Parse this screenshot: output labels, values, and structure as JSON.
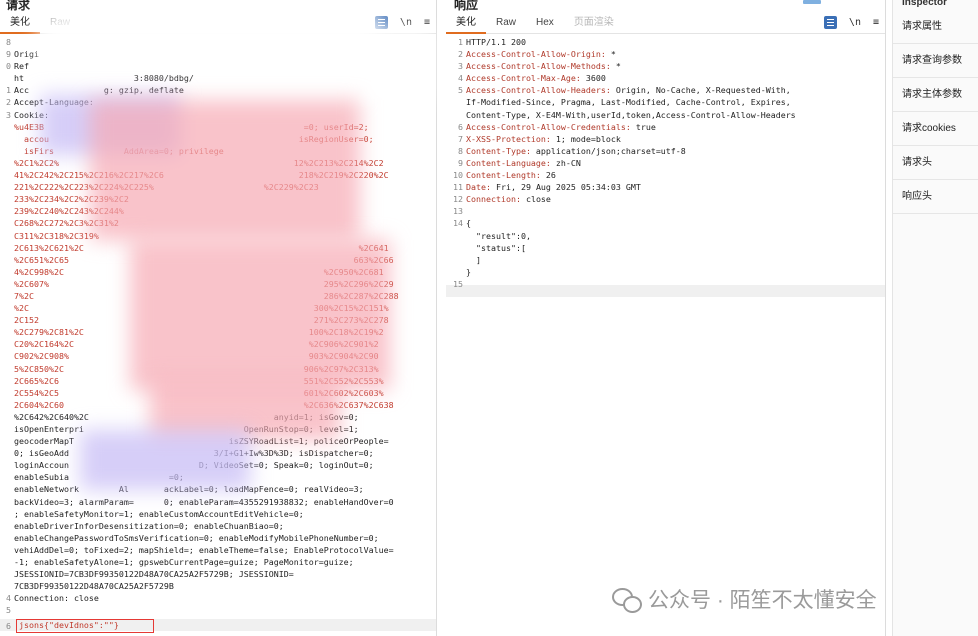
{
  "request": {
    "title": "请求",
    "tabs": [
      "美化",
      "Raw"
    ],
    "tools": {
      "format_icon": "lines-icon",
      "newline_label": "\\n",
      "menu_label": "≡"
    },
    "lines": [
      {
        "n": "8",
        "text": ""
      },
      {
        "n": "9",
        "text": "Origi"
      },
      {
        "n": "0",
        "text": "Ref"
      },
      {
        "n": "",
        "text": "ht                      3:8080/bdbg/"
      },
      {
        "n": "1",
        "text": "Acc               g: gzip, deflate"
      },
      {
        "n": "2",
        "text": "Accept-Language:"
      },
      {
        "n": "3",
        "text": "Cookie:"
      },
      {
        "n": "",
        "text": "%u4E3B                                                    =0; userId=2;"
      },
      {
        "n": "",
        "text": "  accou                                                  isRegionUser=0;"
      },
      {
        "n": "",
        "text": "  isFirs              AddArea=0; privilege"
      },
      {
        "n": "",
        "text": "%2C1%2C2%                                               12%2C213%2C214%2C2"
      },
      {
        "n": "",
        "text": "41%2C242%2C215%2C216%2C217%2C6                           218%2C219%2C220%2C"
      },
      {
        "n": "",
        "text": "221%2C222%2C223%2C224%2C225%                      %2C229%2C23"
      },
      {
        "n": "",
        "text": "233%2C234%2C2%2C239%2C2"
      },
      {
        "n": "",
        "text": "239%2C240%2C243%2C244%"
      },
      {
        "n": "",
        "text": "C268%2C272%2C3%2C31%2"
      },
      {
        "n": "",
        "text": "C311%2C318%2C319%"
      },
      {
        "n": "",
        "text": "2C613%2C621%2C                                                       %2C641"
      },
      {
        "n": "",
        "text": "%2C651%2C65                                                         663%2C66"
      },
      {
        "n": "",
        "text": "4%2C998%2C                                                    %2C950%2C681"
      },
      {
        "n": "",
        "text": "%2C607%                                                       295%2C296%2C29"
      },
      {
        "n": "",
        "text": "7%2C                                                          286%2C287%2C288"
      },
      {
        "n": "",
        "text": "%2C                                                         300%2C15%2C151%"
      },
      {
        "n": "",
        "text": "2C152                                                       271%2C273%2C278"
      },
      {
        "n": "",
        "text": "%2C279%2C81%2C                                             100%2C18%2C19%2"
      },
      {
        "n": "",
        "text": "C20%2C164%2C                                               %2C906%2C901%2"
      },
      {
        "n": "",
        "text": "C902%2C908%                                                903%2C904%2C90"
      },
      {
        "n": "",
        "text": "5%2C850%2C                                                906%2C97%2C313%"
      },
      {
        "n": "",
        "text": "2C665%2C6                                                 551%2C552%2C553%"
      },
      {
        "n": "",
        "text": "2C554%2C5                                                 601%2C602%2C603%"
      },
      {
        "n": "",
        "text": "2C604%2C60                                                %2C636%2C637%2C638"
      },
      {
        "n": "",
        "text": "%2C642%2C640%2C                                     anyid=1; isGov=0;"
      },
      {
        "n": "",
        "text": "isOpenEnterpri                                OpenRunStop=0; level=1;"
      },
      {
        "n": "",
        "text": "geocoderMapT                               isZSYRoadList=1; policeOrPeople="
      },
      {
        "n": "",
        "text": "0; isGeoAdd                             3/I+G1+Iw%3D%3D; isDispatcher=0;"
      },
      {
        "n": "",
        "text": "loginAccoun                          D; VideoSet=0; Speak=0; loginOut=0;"
      },
      {
        "n": "",
        "text": "enableSubia                    =0;"
      },
      {
        "n": "",
        "text": "enableNetwork        Al       ackLabel=0; loadMapFence=0; realVideo=3;"
      },
      {
        "n": "",
        "text": "backVideo=3; alarmParam=      0; enableParam=4355291938832; enableHandOver=0"
      },
      {
        "n": "",
        "text": "; enableSafetyMonitor=1; enableCustomAccountEditVehicle=0;"
      },
      {
        "n": "",
        "text": "enableDriverInforDesensitization=0; enableChuanBiao=0;"
      },
      {
        "n": "",
        "text": "enableChangePasswordToSmsVerification=0; enableModifyMobilePhoneNumber=0;"
      },
      {
        "n": "",
        "text": "vehiAddDel=0; toFixed=2; mapShield=; enableTheme=false; EnableProtocolValue="
      },
      {
        "n": "",
        "text": "-1; enableSafetyAlone=1; gpswebCurrentPage=guize; PageMonitor=guize;"
      },
      {
        "n": "",
        "text": "JSESSIONID=7CB3DF99350122D48A70CA25A2F5729B; JSESSIONID="
      },
      {
        "n": "",
        "text": "7CB3DF99350122D48A70CA25A2F5729B"
      },
      {
        "n": "4",
        "text": "Connection: close"
      },
      {
        "n": "5",
        "text": ""
      }
    ],
    "last_line_no": "6",
    "body_text": "jsons{\"devIdnos\":\"\"}"
  },
  "response": {
    "title": "响应",
    "tabs": [
      "美化",
      "Raw",
      "Hex",
      "页面渲染"
    ],
    "tools": {
      "format_icon": "lines-icon",
      "newline_label": "\\n",
      "menu_label": "≡"
    },
    "lines": [
      {
        "n": "1",
        "name": "",
        "value": "HTTP/1.1 200"
      },
      {
        "n": "2",
        "name": "Access-Control-Allow-Origin:",
        "value": " *"
      },
      {
        "n": "3",
        "name": "Access-Control-Allow-Methods:",
        "value": " *"
      },
      {
        "n": "4",
        "name": "Access-Control-Max-Age:",
        "value": " 3600"
      },
      {
        "n": "5",
        "name": "Access-Control-Allow-Headers:",
        "value": " Origin, No-Cache, X-Requested-With,"
      },
      {
        "n": "",
        "name": "",
        "value": "If-Modified-Since, Pragma, Last-Modified, Cache-Control, Expires,"
      },
      {
        "n": "",
        "name": "",
        "value": "Content-Type, X-E4M-With,userId,token,Access-Control-Allow-Headers"
      },
      {
        "n": "6",
        "name": "Access-Control-Allow-Credentials:",
        "value": " true"
      },
      {
        "n": "7",
        "name": "X-XSS-Protection:",
        "value": " 1; mode=block"
      },
      {
        "n": "8",
        "name": "Content-Type:",
        "value": " application/json;charset=utf-8"
      },
      {
        "n": "9",
        "name": "Content-Language:",
        "value": " zh-CN"
      },
      {
        "n": "10",
        "name": "Content-Length:",
        "value": " 26"
      },
      {
        "n": "11",
        "name": "Date:",
        "value": " Fri, 29 Aug 2025 05:34:03 GMT"
      },
      {
        "n": "12",
        "name": "Connection:",
        "value": " close"
      },
      {
        "n": "13",
        "name": "",
        "value": ""
      },
      {
        "n": "14",
        "name": "",
        "value": "{"
      },
      {
        "n": "",
        "name": "",
        "value": "  \"result\":0,"
      },
      {
        "n": "",
        "name": "",
        "value": "  \"status\":["
      },
      {
        "n": "",
        "name": "",
        "value": "  ]"
      },
      {
        "n": "",
        "name": "",
        "value": "}"
      },
      {
        "n": "15",
        "name": "",
        "value": ""
      }
    ]
  },
  "inspector": {
    "title": "Inspector",
    "items": [
      "请求属性",
      "请求查询参数",
      "请求主体参数",
      "请求cookies",
      "请求头",
      "响应头"
    ]
  },
  "watermark": {
    "icon": "wechat-icon",
    "text": "公众号 · 陌笙不太懂安全"
  },
  "colors": {
    "accent": "#e06c1f",
    "header_name": "#b0392a",
    "cookie_text": "#c0392b",
    "highlight_box": "#e53935"
  }
}
